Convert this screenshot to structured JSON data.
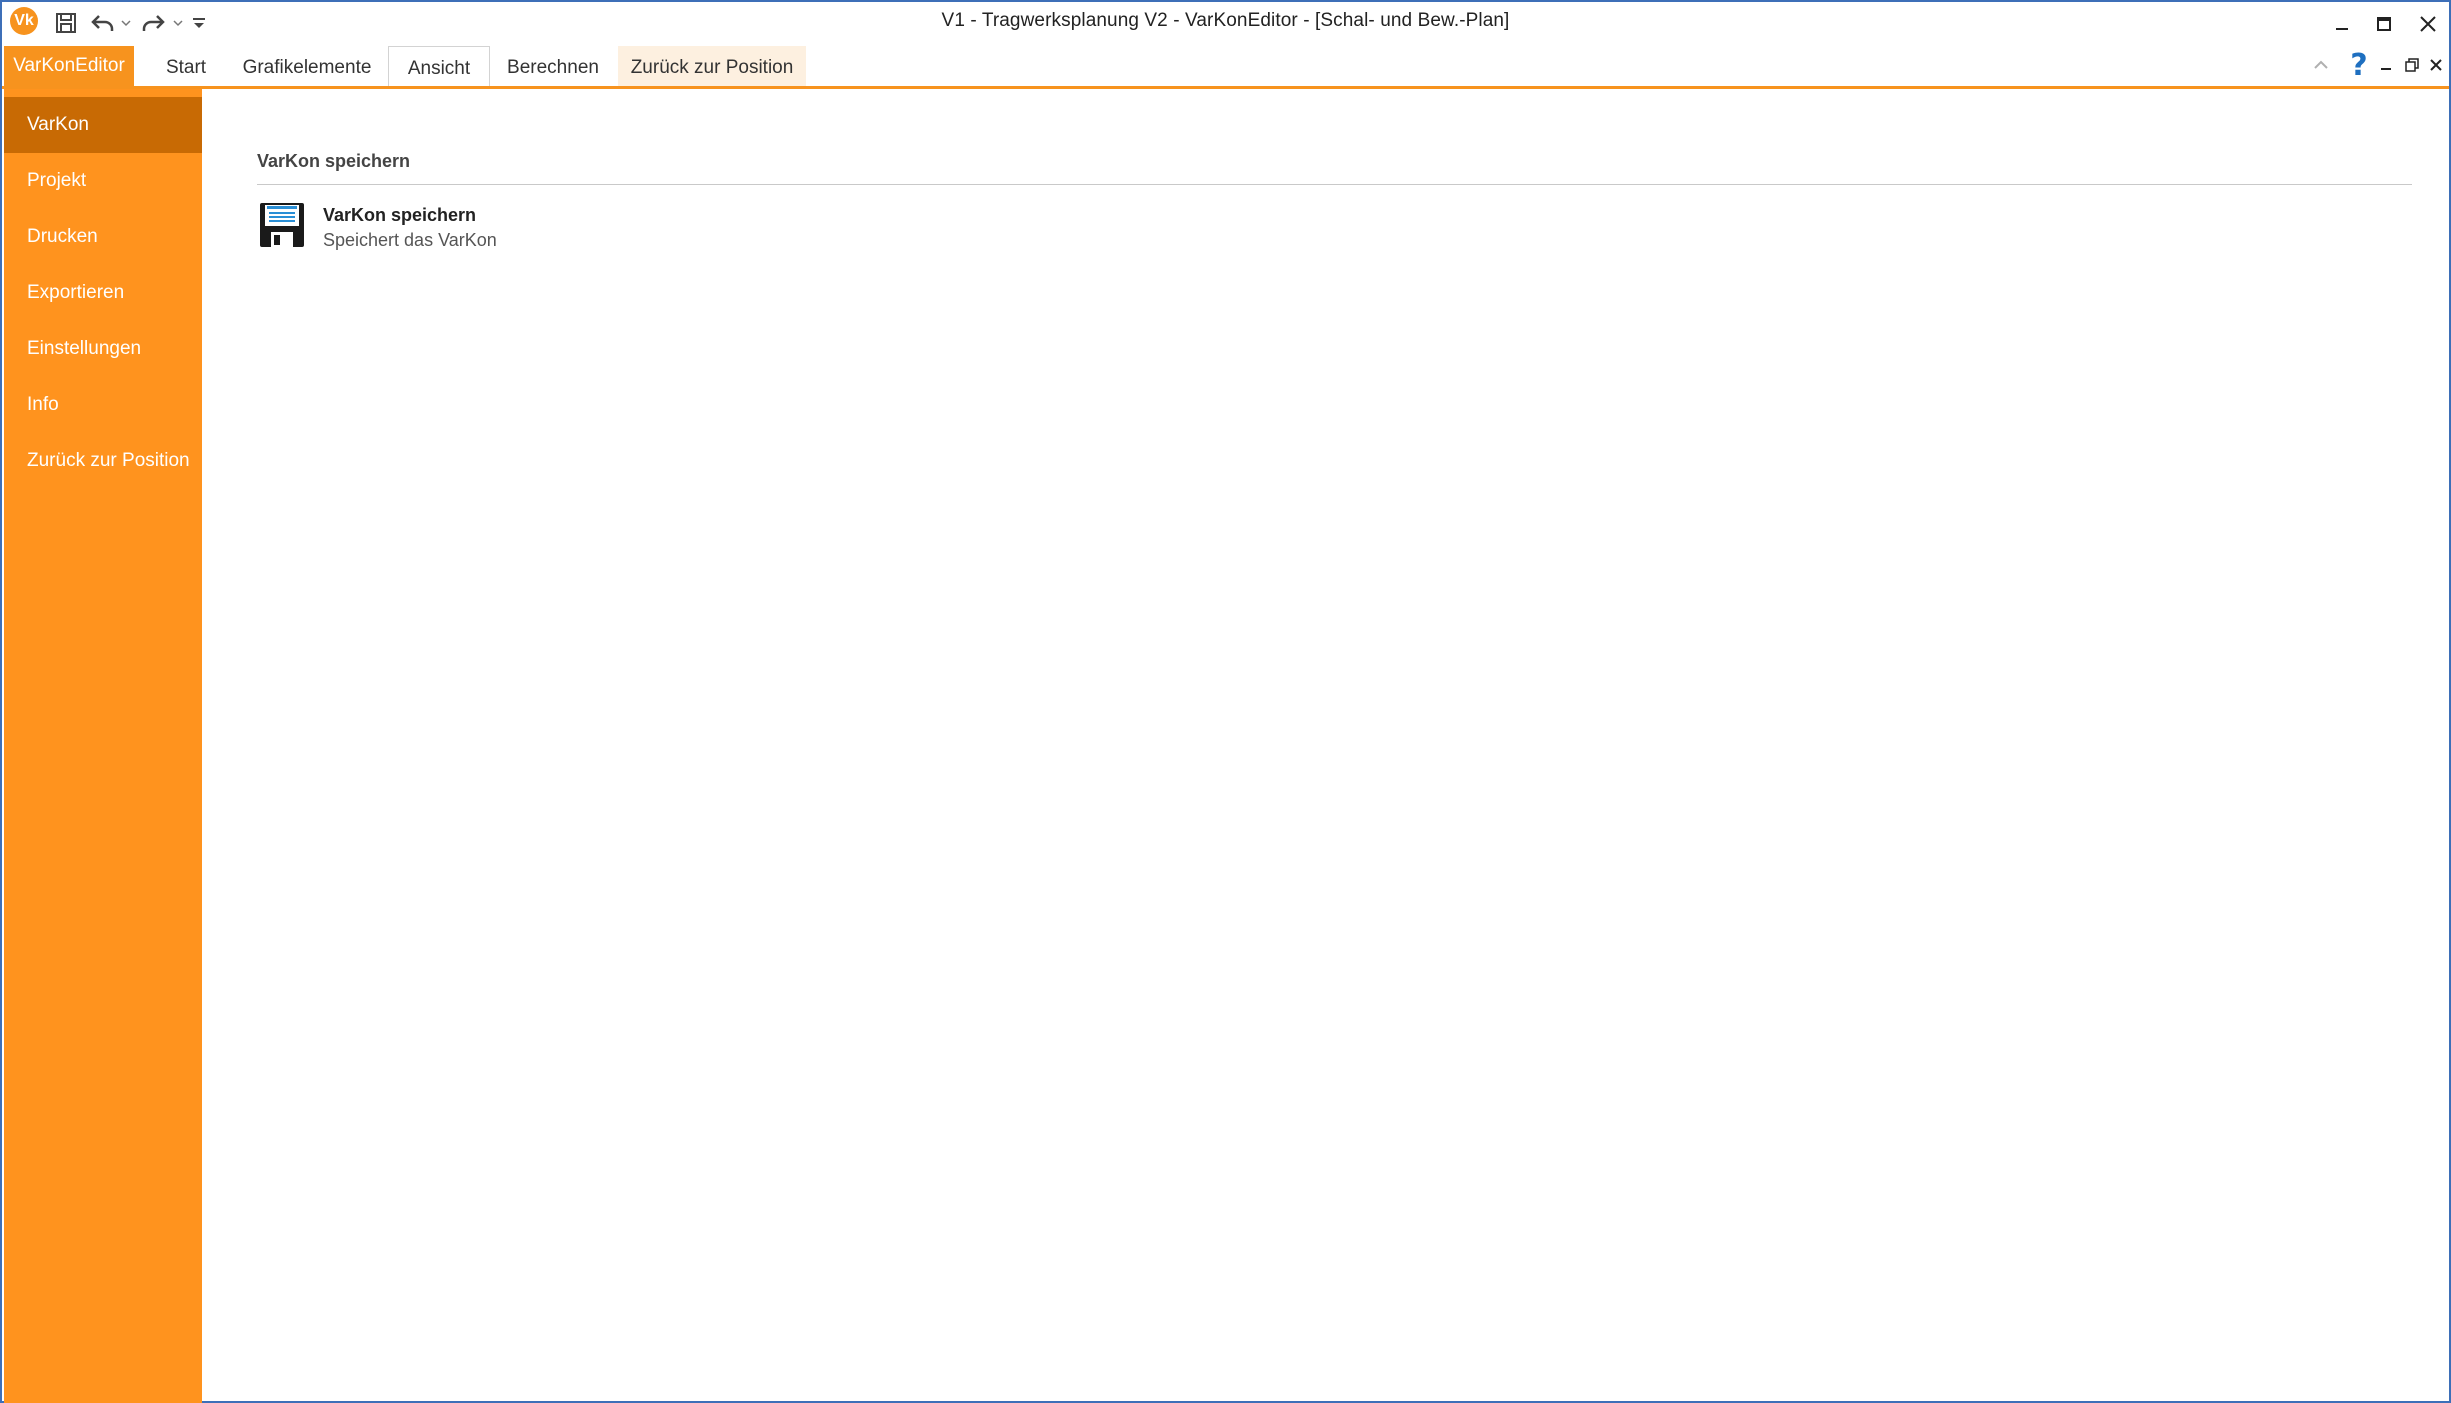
{
  "window": {
    "title": "V1 - Tragwerksplanung V2 - VarKonEditor - [Schal- und Bew.-Plan]",
    "logo_text": "Vk"
  },
  "quick_access": {
    "icons": [
      "save-icon",
      "undo-icon",
      "dropdown-arrow-icon",
      "redo-icon",
      "dropdown-arrow-icon",
      "customize-icon"
    ]
  },
  "ribbon": {
    "file_tab": "VarKonEditor",
    "tabs": [
      {
        "label": "Start"
      },
      {
        "label": "Grafikelemente"
      },
      {
        "label": "Ansicht"
      },
      {
        "label": "Berechnen"
      },
      {
        "label": "Zurück zur Position"
      }
    ],
    "help_glyph": "?"
  },
  "sidebar": {
    "items": [
      {
        "label": "VarKon",
        "active": true
      },
      {
        "label": "Projekt"
      },
      {
        "label": "Drucken"
      },
      {
        "label": "Exportieren"
      },
      {
        "label": "Einstellungen"
      },
      {
        "label": "Info"
      },
      {
        "label": "Zurück zur Position"
      }
    ]
  },
  "content": {
    "section_title": "VarKon speichern",
    "actions": [
      {
        "title": "VarKon speichern",
        "description": "Speichert das VarKon",
        "icon": "floppy-disk-icon"
      }
    ]
  },
  "colors": {
    "accent": "#f7931e",
    "sidebar_bg": "#ff931e",
    "sidebar_active": "#c86a04",
    "window_border": "#3d6fb8",
    "help": "#1e6fc0"
  }
}
